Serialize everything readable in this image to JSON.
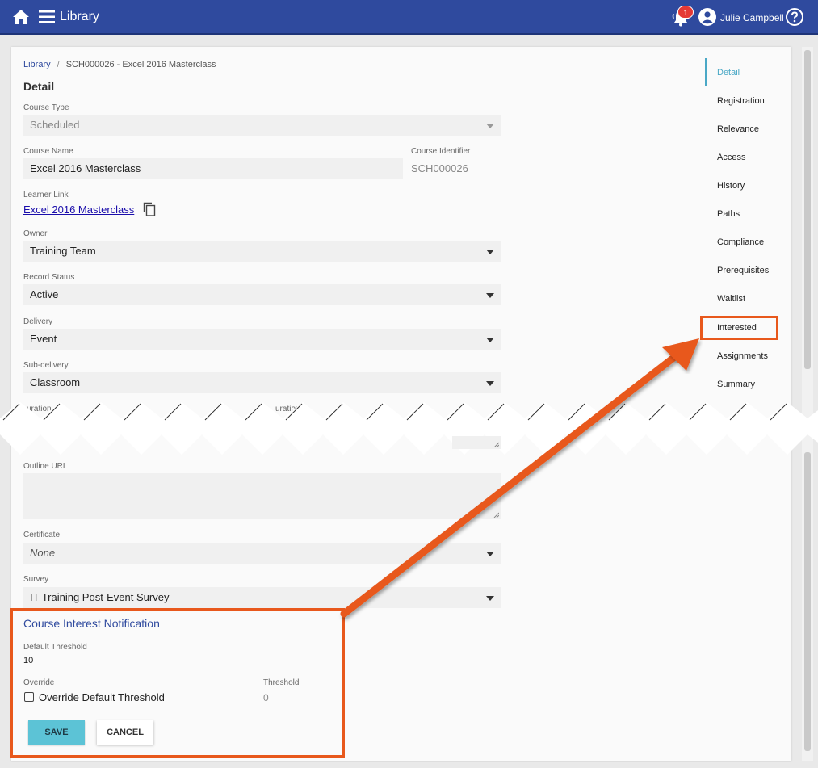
{
  "header": {
    "title": "Library",
    "notification_count": "1",
    "user_name": "Julie Campbell",
    "icons": [
      "home-icon",
      "menu-icon",
      "bell-icon",
      "account-icon",
      "help-icon"
    ],
    "bar_color": "#2f4a9e"
  },
  "breadcrumb": {
    "root": "Library",
    "separator": "/",
    "current": "SCH000026 - Excel 2016 Masterclass"
  },
  "section_title": "Detail",
  "form": {
    "course_type_label": "Course Type",
    "course_type_value": "Scheduled",
    "course_name_label": "Course Name",
    "course_name_value": "Excel 2016 Masterclass",
    "course_identifier_label": "Course Identifier",
    "course_identifier_value": "SCH000026",
    "learner_link_label": "Learner Link",
    "learner_link_value": "Excel 2016 Masterclass",
    "owner_label": "Owner",
    "owner_value": "Training Team",
    "record_status_label": "Record Status",
    "record_status_value": "Active",
    "delivery_label": "Delivery",
    "delivery_value": "Event",
    "sub_delivery_label": "Sub-delivery",
    "sub_delivery_value": "Classroom",
    "duration_label_partial": "uration",
    "duration_label_partial_2": "uration",
    "outline_url_label": "Outline URL",
    "certificate_label": "Certificate",
    "certificate_value": "None",
    "survey_label": "Survey",
    "survey_value": "IT Training Post-Event Survey"
  },
  "interest": {
    "title": "Course Interest Notification",
    "default_threshold_label": "Default Threshold",
    "default_threshold_value": "10",
    "override_label": "Override",
    "override_checkbox_label": "Override Default Threshold",
    "threshold_label": "Threshold",
    "threshold_value": "0",
    "save_label": "SAVE",
    "cancel_label": "CANCEL"
  },
  "side_nav": {
    "items": [
      {
        "label": "Detail",
        "active": true
      },
      {
        "label": "Registration"
      },
      {
        "label": "Relevance"
      },
      {
        "label": "Access"
      },
      {
        "label": "History"
      },
      {
        "label": "Paths"
      },
      {
        "label": "Compliance"
      },
      {
        "label": "Prerequisites"
      },
      {
        "label": "Waitlist"
      },
      {
        "label": "Interested"
      },
      {
        "label": "Assignments"
      },
      {
        "label": "Summary"
      }
    ],
    "active_color": "#4aa8c6"
  },
  "annotation": {
    "highlight_color": "#e8581c"
  }
}
